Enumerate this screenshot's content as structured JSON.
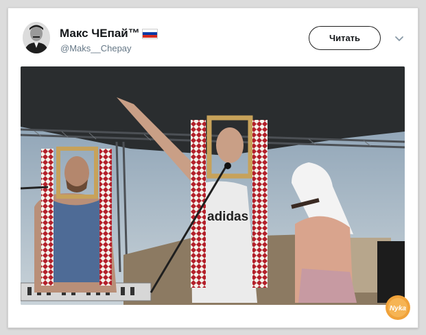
{
  "tweet": {
    "author_name": "Макс ЧЕпай™",
    "author_handle": "@Maks__Chepay",
    "follow_label": "Читать",
    "flag_colors": [
      "#ffffff",
      "#0039a6",
      "#d52b1e"
    ]
  },
  "photo": {
    "shirt_text": "adidas"
  },
  "watermark": {
    "text": "Nyka"
  },
  "colors": {
    "text_primary": "#14171a",
    "text_secondary": "#657786",
    "card_bg": "#ffffff"
  }
}
